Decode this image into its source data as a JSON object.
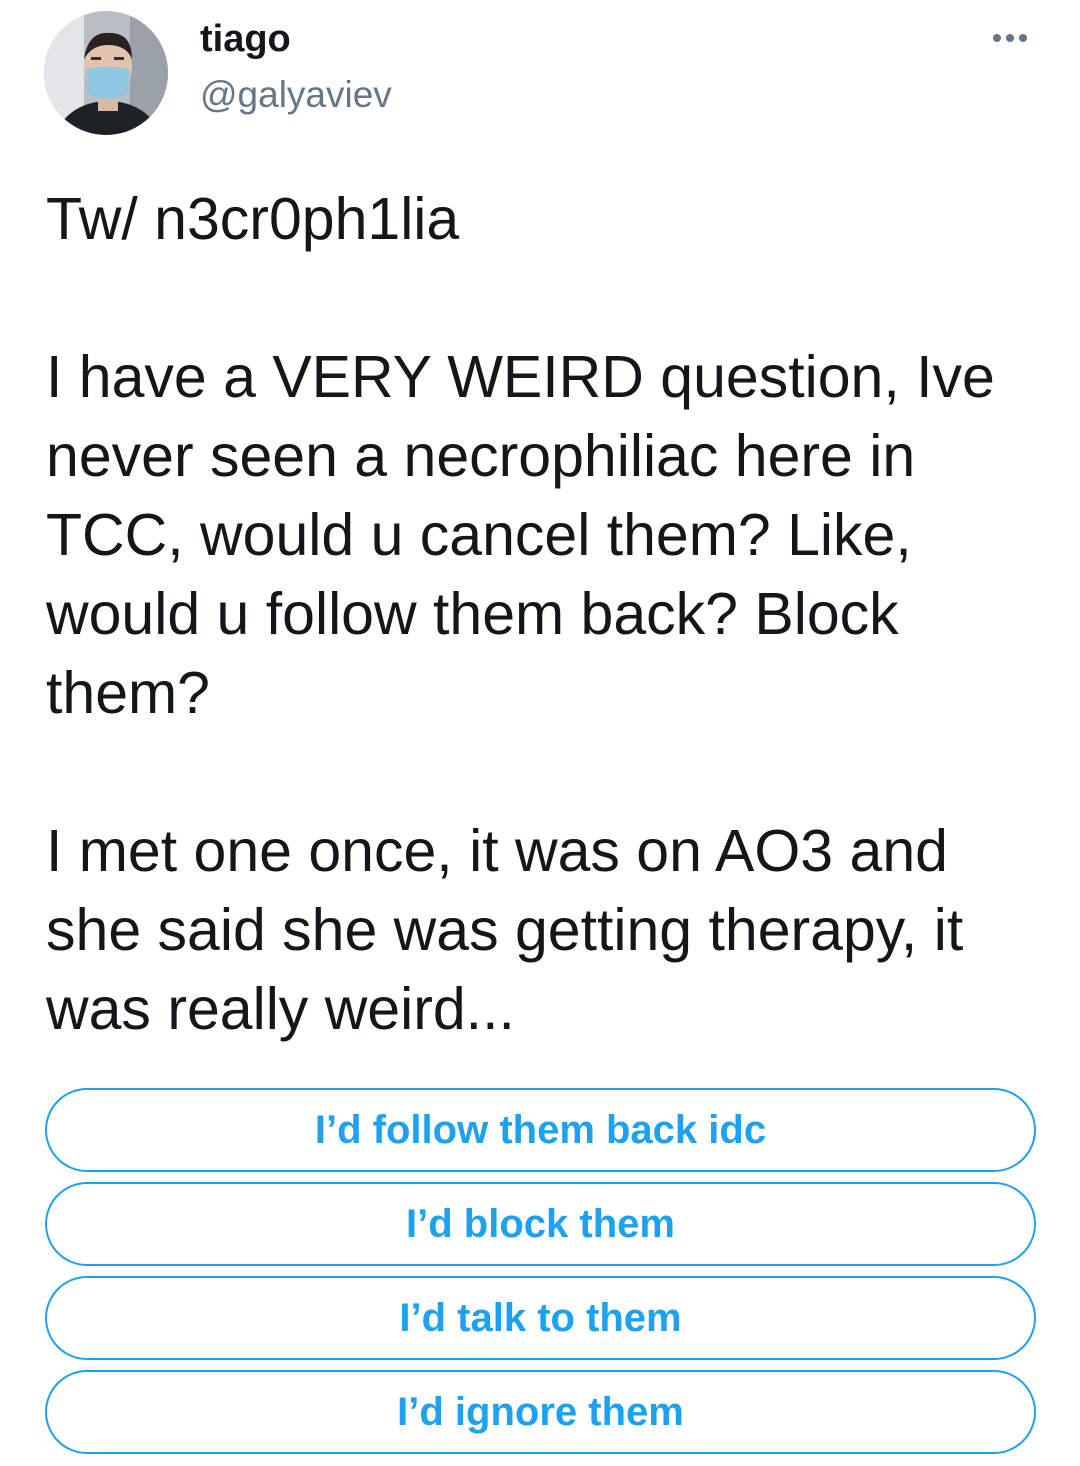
{
  "author": {
    "name": "tiago",
    "handle": "@galyaviev",
    "avatar_icon": "profile-photo"
  },
  "menu_icon": "more-options-icon",
  "tweet": {
    "paragraphs": [
      "Tw/ n3cr0ph1lia",
      "I have a VERY WEIRD question, Ive never seen a necrophiliac here in TCC, would u cancel them? Like, would u follow them back? Block them?",
      "I met one once, it was on AO3 and she said she was getting therapy, it was really weird..."
    ]
  },
  "poll": {
    "options": [
      "I’d follow them back idc",
      "I’d block them",
      "I’d talk to them",
      "I’d ignore them"
    ]
  },
  "colors": {
    "accent": "#1da1f2",
    "text": "#14171a",
    "secondary": "#657786"
  }
}
